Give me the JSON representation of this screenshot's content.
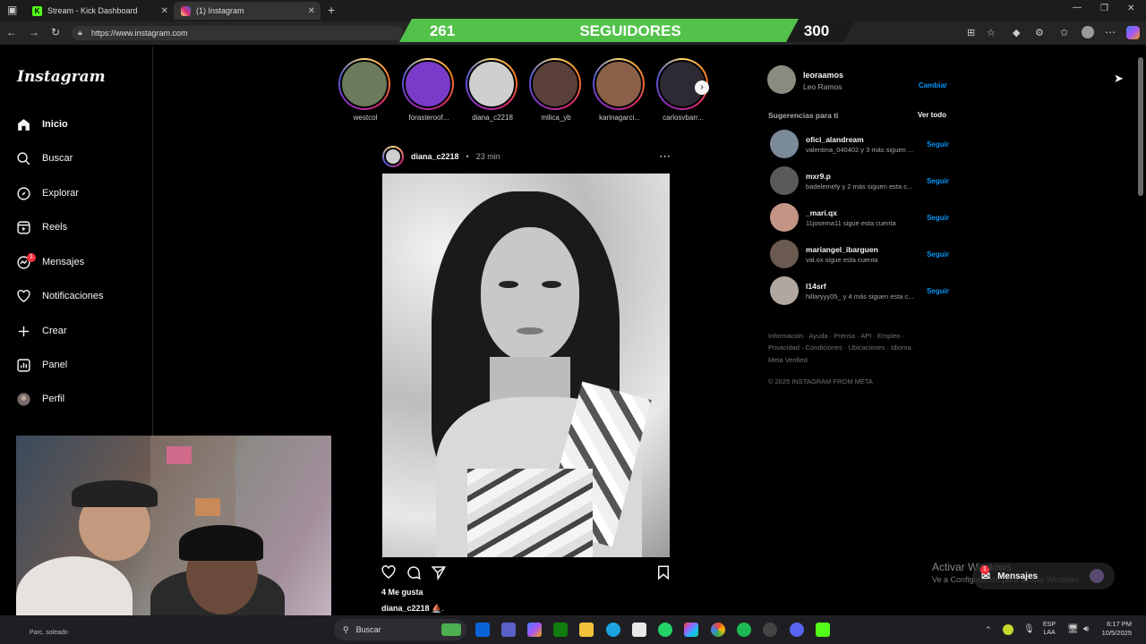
{
  "browser": {
    "tabs": [
      {
        "label": "Stream - Kick Dashboard",
        "icon": "kick-icon"
      },
      {
        "label": "(1) Instagram",
        "icon": "instagram-icon"
      }
    ],
    "url": "https://www.instagram.com"
  },
  "banner": {
    "left_count": "261",
    "label": "SEGUIDORES",
    "right_count": "300",
    "progress": 0.87,
    "fill_color": "#53c24a"
  },
  "instagram": {
    "logo": "Instagram",
    "nav": [
      {
        "label": "Inicio",
        "icon": "home-icon"
      },
      {
        "label": "Buscar",
        "icon": "search-icon"
      },
      {
        "label": "Explorar",
        "icon": "compass-icon"
      },
      {
        "label": "Reels",
        "icon": "reels-icon"
      },
      {
        "label": "Mensajes",
        "icon": "messenger-icon"
      },
      {
        "label": "Notificaciones",
        "icon": "heart-icon"
      },
      {
        "label": "Crear",
        "icon": "plus-icon"
      },
      {
        "label": "Panel",
        "icon": "dashboard-icon"
      },
      {
        "label": "Perfil",
        "icon": "avatar-icon"
      }
    ],
    "messages_badge": "1",
    "stories": [
      {
        "name": "westcol",
        "seen": false,
        "color": "#6a7a5a"
      },
      {
        "name": "forasteroof...",
        "seen": false,
        "color": "#7a3cc8"
      },
      {
        "name": "diana_c2218",
        "seen": false,
        "color": "#cfcfcf"
      },
      {
        "name": "milica_yb",
        "seen": false,
        "color": "#5a4038"
      },
      {
        "name": "karinagarci...",
        "seen": false,
        "color": "#8a6048"
      },
      {
        "name": "carlosvbarr...",
        "seen": false,
        "color": "#2e2a34"
      }
    ],
    "post": {
      "username": "diana_c2218",
      "time": "23 min",
      "likes": "4 Me gusta",
      "caption_user": "diana_c2218",
      "caption_text": "⛵."
    },
    "profile": {
      "username": "leoraamos",
      "full_name": "Leo Ramos",
      "switch_label": "Cambiar"
    },
    "suggestions_title": "Sugerencias para ti",
    "see_all": "Ver todo",
    "suggestions": [
      {
        "username": "ofici_alandream",
        "subtitle": "valentina_040402 y 3 más siguen ...",
        "follow": "Seguir",
        "color": "#7a8a98"
      },
      {
        "username": "mxr9.p",
        "subtitle": "badelemely y 2 más siguen esta c...",
        "follow": "Seguir",
        "color": "#5a5a5a"
      },
      {
        "username": "_mari.qx",
        "subtitle": "11josema11 sigue esta cuenta",
        "follow": "Seguir",
        "color": "#c49484"
      },
      {
        "username": "mariangel_ibarguen",
        "subtitle": "val.ox sigue esta cuenta",
        "follow": "Seguir",
        "color": "#6a5a50"
      },
      {
        "username": "l14srf",
        "subtitle": "hillaryyy05_ y 4 más siguen esta c...",
        "follow": "Seguir",
        "color": "#b0a8a0"
      }
    ],
    "footer_lines": [
      "Información · Ayuda · Prensa · API · Empleo ·",
      "Privacidad · Condiciones · Ubicaciones · Idioma ·",
      "Meta Verified"
    ],
    "copyright": "© 2025 INSTAGRAM FROM META",
    "messages_pill": "Mensajes"
  },
  "watermark": {
    "line1": "Activar Windows",
    "line2": "Ve a Configuración para activar Windows."
  },
  "taskbar": {
    "search_placeholder": "Buscar",
    "lang_top": "ESP",
    "lang_bottom": "LAA",
    "time": "6:17 PM",
    "date": "10/5/2025",
    "webcam_label": "Parc. soleado"
  }
}
